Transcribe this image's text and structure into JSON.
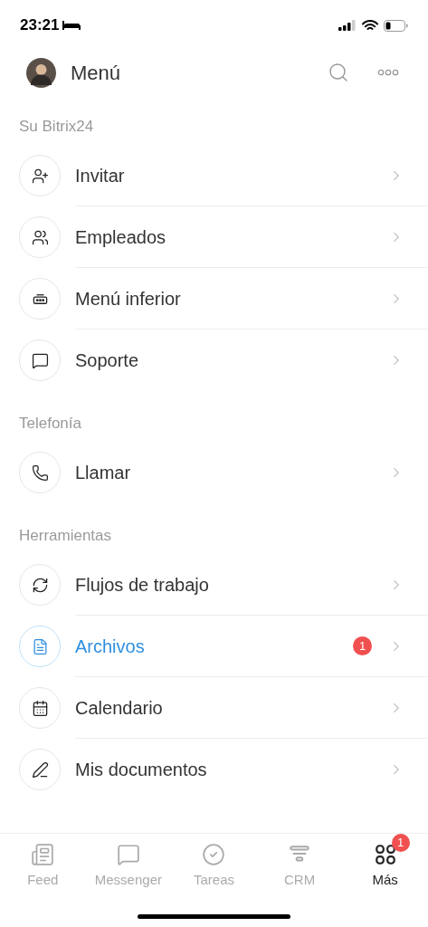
{
  "status_bar": {
    "time": "23:21"
  },
  "header": {
    "title": "Menú"
  },
  "sections": [
    {
      "title": "Su Bitrix24",
      "items": [
        {
          "label": "Invitar",
          "kind": "invite",
          "selected": false
        },
        {
          "label": "Empleados",
          "kind": "people",
          "selected": false
        },
        {
          "label": "Menú inferior",
          "kind": "bar",
          "selected": false
        },
        {
          "label": "Soporte",
          "kind": "support",
          "selected": false
        }
      ]
    },
    {
      "title": "Telefonía",
      "items": [
        {
          "label": "Llamar",
          "kind": "phone",
          "selected": false
        }
      ]
    },
    {
      "title": "Herramientas",
      "items": [
        {
          "label": "Flujos de trabajo",
          "kind": "flow",
          "selected": false
        },
        {
          "label": "Archivos",
          "kind": "file",
          "selected": true,
          "badge": "1"
        },
        {
          "label": "Calendario",
          "kind": "calendar",
          "selected": false
        },
        {
          "label": "Mis documentos",
          "kind": "sign",
          "selected": false
        }
      ]
    }
  ],
  "tabs": [
    {
      "label": "Feed",
      "kind": "feed",
      "selected": false
    },
    {
      "label": "Messenger",
      "kind": "chat",
      "selected": false
    },
    {
      "label": "Tareas",
      "kind": "check",
      "selected": false
    },
    {
      "label": "CRM",
      "kind": "crm",
      "selected": false
    },
    {
      "label": "Más",
      "kind": "grid",
      "selected": true,
      "badge": "1"
    }
  ]
}
